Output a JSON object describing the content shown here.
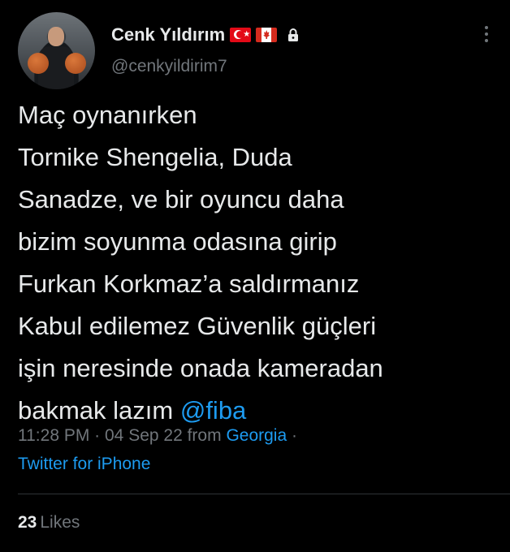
{
  "author": {
    "display_name": "Cenk Yıldırım",
    "handle": "@cenkyildirim7",
    "badges": [
      "turkey-flag",
      "canada-flag",
      "lock-icon"
    ]
  },
  "tweet": {
    "text": "Maç oynanırken\nTornike Shengelia, Duda\nSanadze, ve bir oyuncu daha\nbizim soyunma odasına girip\nFurkan Korkmaz’a saldırmanız\nKabul  edilemez Güvenlik güçleri\nişin neresinde onada kameradan\nbakmak lazım ",
    "mention": "@fiba"
  },
  "meta": {
    "time": "11:28 PM",
    "sep1": " · ",
    "date": "04 Sep 22",
    "from_label": " from ",
    "location": "Georgia",
    "sep2": " ·",
    "source": "Twitter for iPhone"
  },
  "stats": {
    "likes_count": "23",
    "likes_label": "Likes"
  },
  "colors": {
    "background": "#000000",
    "text": "#e7e9ea",
    "secondary": "#71767b",
    "accent": "#1d9bf0"
  }
}
